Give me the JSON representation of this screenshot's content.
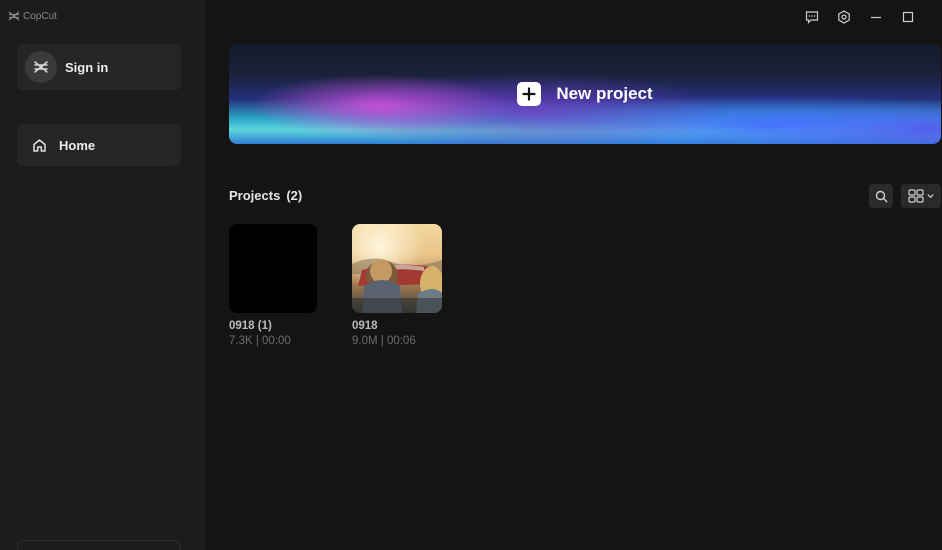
{
  "app": {
    "brand_name": "CopCut",
    "brand_icon": "capcut-logo-icon"
  },
  "sidebar": {
    "signin_label": "Sign in",
    "nav": [
      {
        "label": "Home",
        "icon": "home-icon"
      }
    ]
  },
  "window_controls": [
    "feedback-icon",
    "settings-icon",
    "minimize-icon",
    "maximize-icon"
  ],
  "banner": {
    "label": "New project",
    "icon": "plus-icon"
  },
  "projects": {
    "title": "Projects",
    "count": "(2)",
    "items": [
      {
        "name": "0918 (1)",
        "meta": "7.3K | 00:00",
        "thumbnail": "black"
      },
      {
        "name": "0918",
        "meta": "9.0M | 00:06",
        "thumbnail": "convertible-car-sunset"
      }
    ]
  },
  "colors": {
    "background": "#141414",
    "sidebar": "#1c1c1c",
    "button": "#262626",
    "text_primary": "#ececec",
    "text_muted": "#6d6d6d"
  }
}
